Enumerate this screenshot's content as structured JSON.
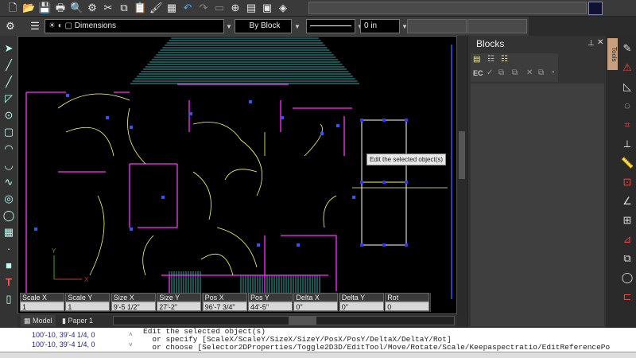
{
  "toolbar": {
    "icons": [
      "new-file-icon",
      "open-folder-icon",
      "save-icon",
      "print-icon",
      "print-preview-icon",
      "settings-gear-icon",
      "cut-icon",
      "copy-icon",
      "paste-icon",
      "match-properties-icon",
      "view-icon",
      "undo-icon",
      "redo-icon",
      "insert-icon",
      "snap-icon",
      "window-icon",
      "layout-icon",
      "help-icon"
    ],
    "search_value": ""
  },
  "layer_bar": {
    "layer_name": "Dimensions",
    "color": "By Block",
    "linetype": "",
    "lineweight": "0 in",
    "extra1": "",
    "extra2": ""
  },
  "properties": [
    {
      "label": "Scale X",
      "value": "1"
    },
    {
      "label": "Scale Y",
      "value": "1"
    },
    {
      "label": "Size X",
      "value": "9'-5 1/2\""
    },
    {
      "label": "Size Y",
      "value": "27'-2\""
    },
    {
      "label": "Pos X",
      "value": "96'-7 3/4\""
    },
    {
      "label": "Pos Y",
      "value": "44'-5\""
    },
    {
      "label": "Delta X",
      "value": "0\""
    },
    {
      "label": "Delta Y",
      "value": "0\""
    },
    {
      "label": "Rot",
      "value": "0"
    }
  ],
  "tooltip": "Edit the selected object(s)",
  "tabs": [
    {
      "label": "Model"
    },
    {
      "label": "Paper 1"
    }
  ],
  "blocks_panel": {
    "title": "Blocks",
    "side_tab": "Tools",
    "ec_label": "EC"
  },
  "history": [
    "100'-10, 39'-4 1/4, 0",
    "100'-10, 39'-4 1/4, 0"
  ],
  "command_lines": [
    "Edit the selected object(s)",
    "  or specify [ScaleX/ScaleY/SizeX/SizeY/PosX/PosY/DeltaX/DeltaY/Rot]",
    "  or choose [Selector2DProperties/Toggle2D3D/EditTool/Move/Rotate/Scale/Keepaspectratio/EditReferencePo"
  ],
  "colors": {
    "canvas": "#000000",
    "walls": "#ff00ff",
    "wiring": "#ffff66",
    "hatch": "#33aaaa",
    "dims": "#3355ff",
    "selection": "#ffffff"
  }
}
